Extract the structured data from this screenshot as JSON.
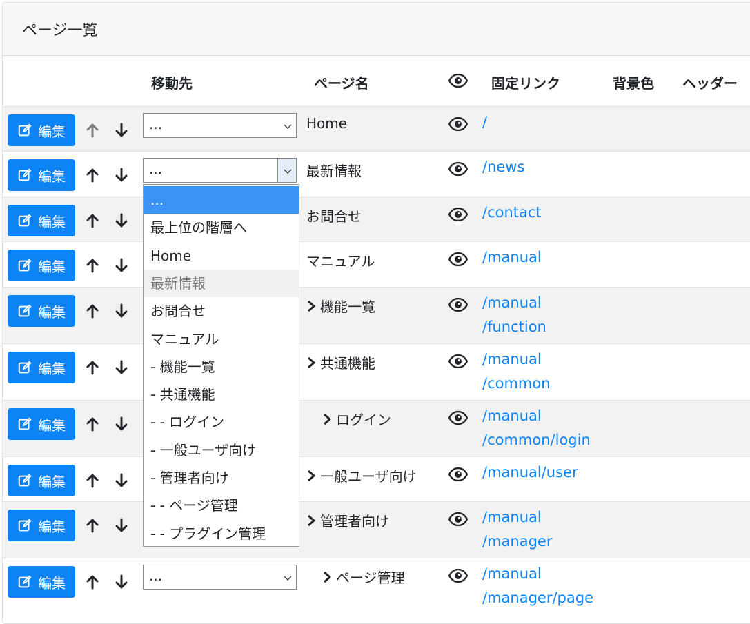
{
  "card": {
    "title": "ページ一覧"
  },
  "table": {
    "headers": {
      "move_to": "移動先",
      "page_name": "ページ名",
      "visibility_icon": "eye-icon",
      "permalink": "固定リンク",
      "bg_color": "背景色",
      "header": "ヘッダー"
    }
  },
  "edit_label": "編集",
  "rows": [
    {
      "select": "...",
      "name": "Home",
      "link1": "/",
      "link2": ""
    },
    {
      "select": "...",
      "name": "最新情報",
      "link1": "/news",
      "link2": ""
    },
    {
      "select": "",
      "name": "お問合せ",
      "link1": "/contact",
      "link2": ""
    },
    {
      "select": "",
      "name": "マニュアル",
      "link1": "/manual",
      "link2": ""
    },
    {
      "select": "",
      "name": "機能一覧",
      "link1": "/manual",
      "link2": "/function"
    },
    {
      "select": "",
      "name": "共通機能",
      "link1": "/manual",
      "link2": "/common"
    },
    {
      "select": "",
      "name": "ログイン",
      "link1": "/manual",
      "link2": "/common/login"
    },
    {
      "select": "",
      "name": "一般ユーザ向け",
      "link1": "/manual/user",
      "link2": ""
    },
    {
      "select": "",
      "name": "管理者向け",
      "link1": "/manual",
      "link2": "/manager"
    },
    {
      "select": "...",
      "name": "ページ管理",
      "link1": "/manual",
      "link2": "/manager/page"
    }
  ],
  "dropdown": {
    "options": [
      {
        "label": "...",
        "state": "selected"
      },
      {
        "label": "最上位の階層へ",
        "state": "normal"
      },
      {
        "label": "Home",
        "state": "normal"
      },
      {
        "label": "最新情報",
        "state": "disabled"
      },
      {
        "label": "お問合せ",
        "state": "normal"
      },
      {
        "label": "マニュアル",
        "state": "normal"
      },
      {
        "label": "- 機能一覧",
        "state": "normal"
      },
      {
        "label": "- 共通機能",
        "state": "normal"
      },
      {
        "label": "- - ログイン",
        "state": "normal"
      },
      {
        "label": "- 一般ユーザ向け",
        "state": "normal"
      },
      {
        "label": "- 管理者向け",
        "state": "normal"
      },
      {
        "label": "- - ページ管理",
        "state": "normal"
      },
      {
        "label": "- - プラグイン管理",
        "state": "normal"
      }
    ]
  },
  "colors": {
    "primary": "#0d84f5",
    "link": "#0d84f5",
    "selected_option": "#3c93f6",
    "stripe": "#f2f2f2"
  }
}
